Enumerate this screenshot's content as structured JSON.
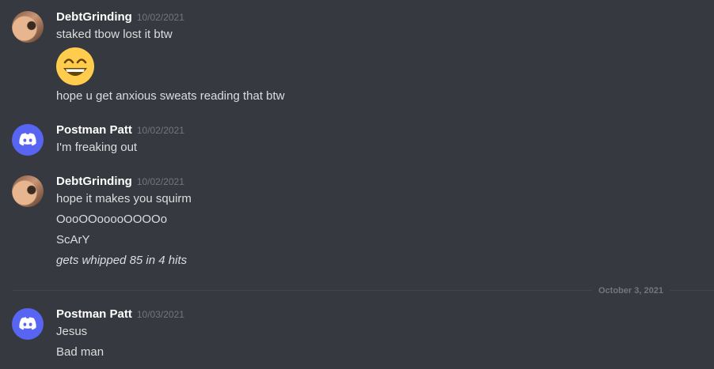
{
  "groups": [
    {
      "username": "DebtGrinding",
      "timestamp": "10/02/2021",
      "avatar": "user-photo-avatar",
      "lines": [
        "staked tbow lost it btw",
        "hope u get anxious sweats reading that btw"
      ],
      "emoji": "grinning-face-with-smiling-eyes-emoji"
    },
    {
      "username": "Postman Patt",
      "timestamp": "10/02/2021",
      "avatar": "discord-logo-icon",
      "lines": [
        "I'm freaking out"
      ]
    },
    {
      "username": "DebtGrinding",
      "timestamp": "10/02/2021",
      "avatar": "user-photo-avatar",
      "lines": [
        "hope it makes you squirm",
        "OooOOooooOOOOo",
        "ScArY",
        "gets whipped 85 in 4 hits"
      ]
    },
    {
      "username": "Postman Patt",
      "timestamp": "10/03/2021",
      "avatar": "discord-logo-icon",
      "lines": [
        "Jesus",
        "Bad man"
      ]
    }
  ],
  "date_divider": "October 3, 2021",
  "colors": {
    "background": "#36393f",
    "username": "#ffffff",
    "timestamp": "#72767d",
    "message_text": "#dcddde",
    "discord_blurple": "#5865f2",
    "emoji_yellow": "#ffcc4d"
  }
}
